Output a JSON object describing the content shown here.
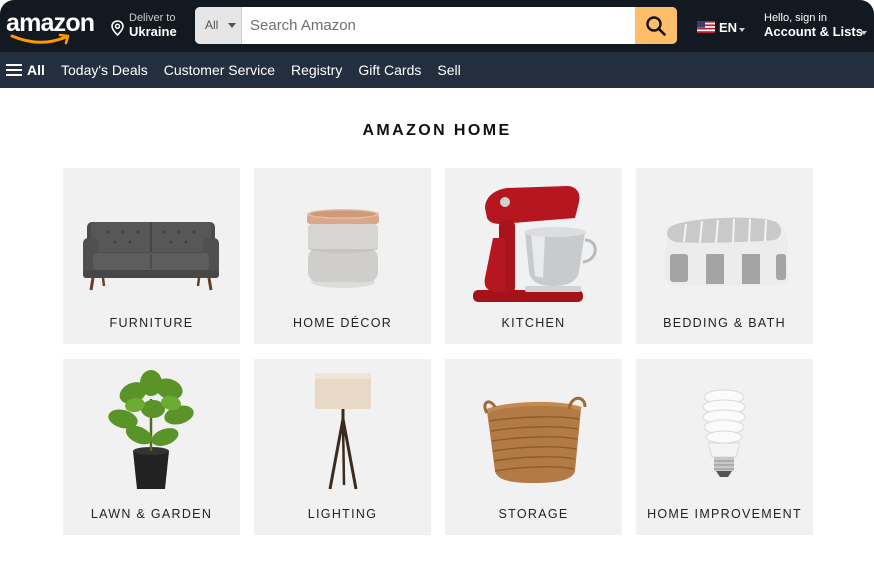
{
  "header": {
    "logo_text": "amazon",
    "deliver_line1": "Deliver to",
    "deliver_line2": "Ukraine",
    "search": {
      "category": "All",
      "placeholder": "Search Amazon"
    },
    "language": "EN",
    "account_line1": "Hello, sign in",
    "account_line2": "Account & Lists"
  },
  "nav": {
    "all_label": "All",
    "links": [
      "Today's Deals",
      "Customer Service",
      "Registry",
      "Gift Cards",
      "Sell"
    ]
  },
  "main": {
    "title": "AMAZON HOME",
    "categories": [
      {
        "label": "FURNITURE",
        "icon": "sofa-image"
      },
      {
        "label": "HOME DÉCOR",
        "icon": "decor-jar-image"
      },
      {
        "label": "KITCHEN",
        "icon": "stand-mixer-image"
      },
      {
        "label": "BEDDING & BATH",
        "icon": "comforter-image"
      },
      {
        "label": "LAWN & GARDEN",
        "icon": "potted-plant-image"
      },
      {
        "label": "LIGHTING",
        "icon": "floor-lamp-image"
      },
      {
        "label": "STORAGE",
        "icon": "basket-image"
      },
      {
        "label": "HOME IMPROVEMENT",
        "icon": "light-bulb-image"
      }
    ]
  },
  "colors": {
    "header_bg": "#131921",
    "nav_bg": "#232f3e",
    "search_button": "#febd69",
    "logo_smile": "#ff9900",
    "tile_bg": "#f1f1f1"
  }
}
